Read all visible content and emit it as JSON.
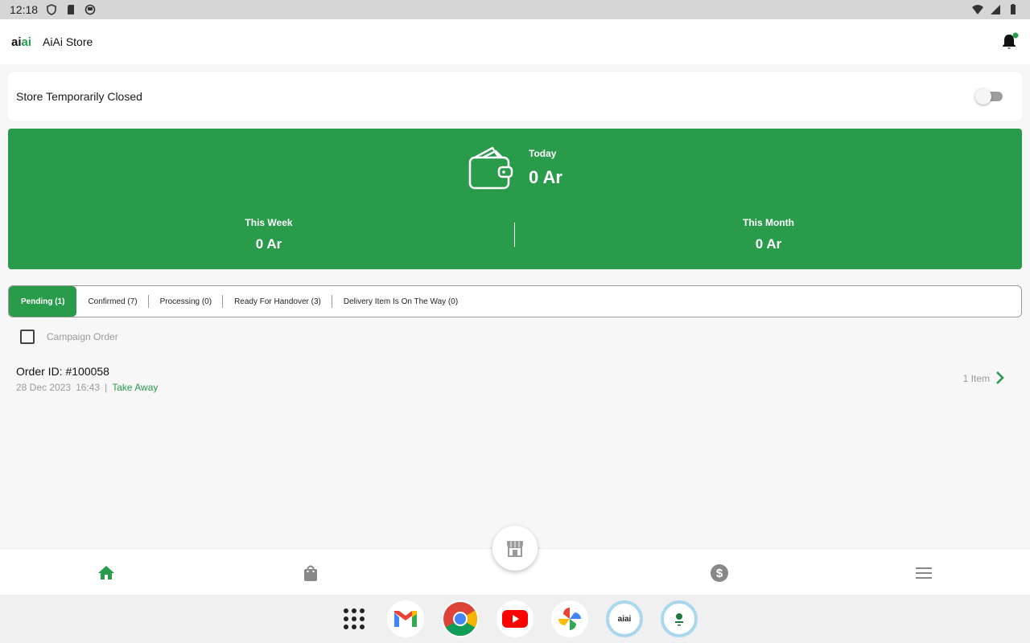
{
  "status_bar": {
    "time": "12:18"
  },
  "app_bar": {
    "logo_part1": "ai",
    "logo_part2": "ai",
    "title": "AiAi Store"
  },
  "store_status": {
    "label": "Store Temporarily Closed",
    "toggle_on": false
  },
  "earnings": {
    "today_label": "Today",
    "today_value": "0 Ar",
    "week_label": "This Week",
    "week_value": "0 Ar",
    "month_label": "This Month",
    "month_value": "0 Ar"
  },
  "tabs": [
    {
      "label": "Pending (1)",
      "active": true
    },
    {
      "label": "Confirmed (7)",
      "active": false
    },
    {
      "label": "Processing (0)",
      "active": false
    },
    {
      "label": "Ready For Handover (3)",
      "active": false
    },
    {
      "label": "Delivery Item Is On The Way (0)",
      "active": false
    }
  ],
  "campaign_filter": {
    "label": "Campaign Order",
    "checked": false
  },
  "orders": [
    {
      "id": "Order ID: #100058",
      "date": "28 Dec 2023",
      "time": "16:43",
      "separator": "|",
      "type": "Take Away",
      "items": "1 Item"
    }
  ],
  "bottom_nav": {
    "items": [
      "home-icon",
      "shopping-bag-icon",
      "store-icon",
      "dollar-icon",
      "menu-icon"
    ],
    "active": "home-icon"
  },
  "dock": {
    "apps": [
      "app-drawer-icon",
      "gmail-icon",
      "chrome-icon",
      "youtube-icon",
      "photos-icon",
      "aiai-app-icon",
      "aiai-store-app-icon"
    ],
    "aiai_label": "aiai"
  },
  "colors": {
    "brand_green": "#2a9a4b",
    "background": "#f7f7f7",
    "status_bar": "#d6d6d6"
  }
}
